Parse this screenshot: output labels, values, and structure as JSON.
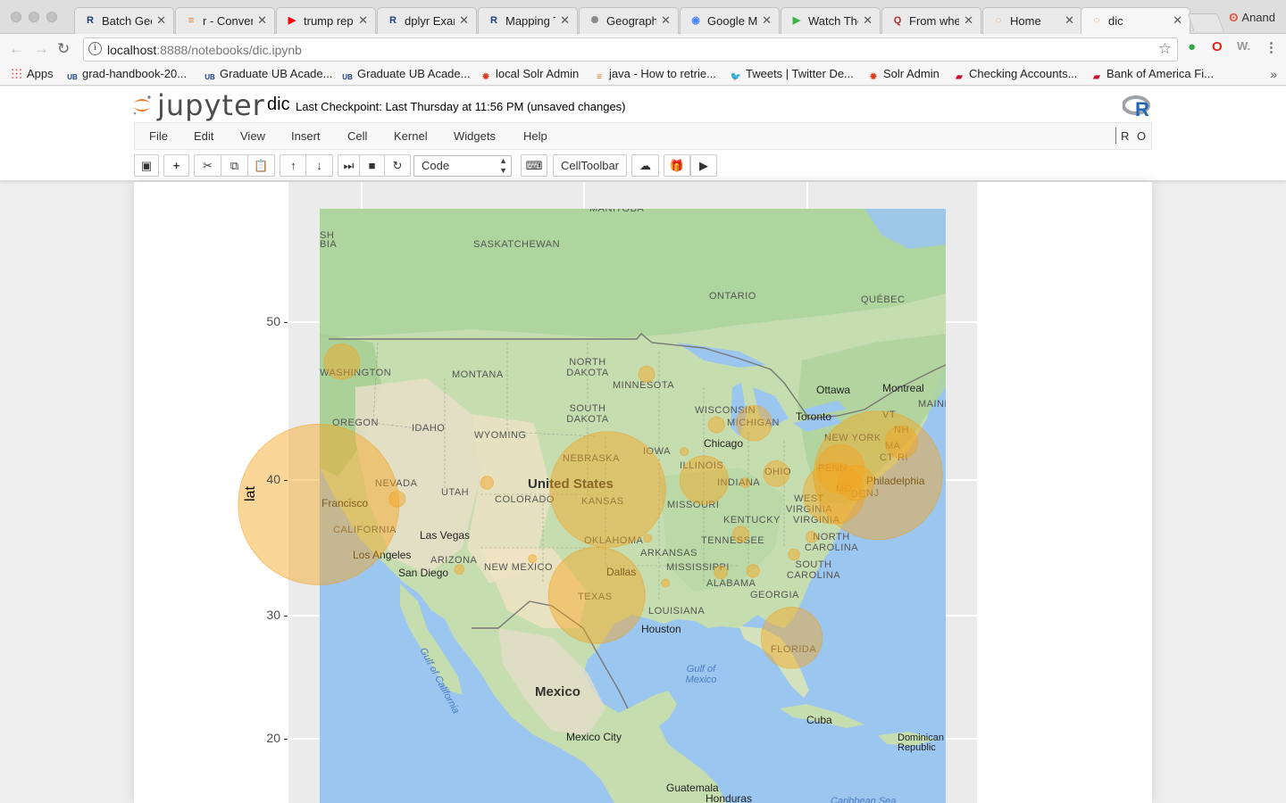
{
  "browser": {
    "tabs": [
      {
        "title": "Batch Geo",
        "icon": "r-icon",
        "color": "#1f3f7a"
      },
      {
        "title": "r - Conver",
        "icon": "stackoverflow-icon",
        "color": "#e87922"
      },
      {
        "title": "trump rep",
        "icon": "youtube-icon",
        "color": "#ff0000"
      },
      {
        "title": "dplyr Exan",
        "icon": "r-icon",
        "color": "#1f3f7a"
      },
      {
        "title": "Mapping T",
        "icon": "r-icon",
        "color": "#1f3f7a"
      },
      {
        "title": "Geographi",
        "icon": "loading-icon",
        "color": "#888888"
      },
      {
        "title": "Google Ma",
        "icon": "google-icon",
        "color": "#4285f4"
      },
      {
        "title": "Watch The",
        "icon": "play-icon",
        "color": "#3ab54a"
      },
      {
        "title": "From wher",
        "icon": "quora-icon",
        "color": "#b92b27"
      },
      {
        "title": "Home",
        "icon": "jupyter-icon",
        "color": "#f37726"
      },
      {
        "title": "dic",
        "icon": "jupyter-icon",
        "color": "#f37726"
      }
    ],
    "active_tab": 10,
    "profile_name": "Anand",
    "url_host": "localhost",
    "url_path": ":8888/notebooks/dic.ipynb",
    "bookmarks": [
      {
        "label": "Apps",
        "icon": "apps-grid-icon"
      },
      {
        "label": "grad-handbook-20...",
        "icon": "ub-icon"
      },
      {
        "label": "Graduate UB Acade...",
        "icon": "ub-icon"
      },
      {
        "label": "Graduate UB Acade...",
        "icon": "ub-icon"
      },
      {
        "label": "local Solr Admin",
        "icon": "solr-icon"
      },
      {
        "label": "java - How to retrie...",
        "icon": "stackoverflow-icon"
      },
      {
        "label": "Tweets | Twitter De...",
        "icon": "twitter-icon"
      },
      {
        "label": "Solr Admin",
        "icon": "solr-icon"
      },
      {
        "label": "Checking Accounts...",
        "icon": "bofa-icon"
      },
      {
        "label": "Bank of America Fi...",
        "icon": "bofa-icon"
      }
    ]
  },
  "jupyter": {
    "logo_text": "jupyter",
    "notebook_name": "dic",
    "checkpoint": "Last Checkpoint: Last Thursday at 11:56 PM (unsaved changes)",
    "menu": [
      "File",
      "Edit",
      "View",
      "Insert",
      "Cell",
      "Kernel",
      "Widgets",
      "Help"
    ],
    "kernel_indicator": "R",
    "kernel_status": "O",
    "cell_type": "Code",
    "celltoolbar_label": "CellToolbar",
    "toolbar_icons": [
      "save-icon",
      "plus-icon",
      "scissors-icon",
      "copy-icon",
      "paste-icon",
      "arrow-up-icon",
      "arrow-down-icon",
      "run-icon",
      "stop-icon",
      "restart-icon",
      "keyboard-icon",
      "upload-icon",
      "gift-icon",
      "video-icon"
    ]
  },
  "chart_data": {
    "type": "scatter",
    "ylabel": "lat",
    "y_ticks": [
      50,
      40,
      30,
      20
    ],
    "map_labels": {
      "regions": [
        "SASKATCHEWAN",
        "ONTARIO",
        "QUÉBEC",
        "WASHINGTON",
        "MONTANA",
        "NORTH DAKOTA",
        "MINNESOTA",
        "SOUTH DAKOTA",
        "OREGON",
        "IDAHO",
        "WYOMING",
        "WISCONSIN",
        "MICHIGAN",
        "NEW YORK",
        "VT",
        "NH",
        "MAINE",
        "MA",
        "CT",
        "RI",
        "NEBRASKA",
        "IOWA",
        "ILLINOIS",
        "INDIANA",
        "OHIO",
        "PENN",
        "MD",
        "DE",
        "NJ",
        "NEVADA",
        "UTAH",
        "COLORADO",
        "KANSAS",
        "MISSOURI",
        "WEST VIRGINIA",
        "VIRGINIA",
        "KENTUCKY",
        "CALIFORNIA",
        "ARIZONA",
        "NEW MEXICO",
        "OKLAHOMA",
        "ARKANSAS",
        "TENNESSEE",
        "NORTH CAROLINA",
        "SOUTH CAROLINA",
        "MISSISSIPPI",
        "ALABAMA",
        "GEORGIA",
        "TEXAS",
        "LOUISIANA",
        "FLORIDA",
        "SH",
        "BIA",
        "MANITOBA"
      ],
      "cities": [
        "Ottawa",
        "Montreal",
        "Toronto",
        "Chicago",
        "Philadelphia",
        "Francisco",
        "Las Vegas",
        "Los Angeles",
        "San Diego",
        "Dallas",
        "Houston",
        "Mexico City",
        "Cuba",
        "Guatemala",
        "Honduras",
        "Dominican Republic"
      ],
      "countries": [
        "United States",
        "Mexico"
      ],
      "water": [
        "Gulf of California",
        "Gulf of Mexico",
        "Caribbean Sea"
      ]
    },
    "points": [
      {
        "lon": -124.1,
        "lat": 38.2,
        "size": 100
      },
      {
        "lon": -73.6,
        "lat": 40.3,
        "size": 80
      },
      {
        "lon": -98.0,
        "lat": 39.3,
        "size": 72
      },
      {
        "lon": -99.0,
        "lat": 31.5,
        "size": 60
      },
      {
        "lon": -77.0,
        "lat": 40.7,
        "size": 30
      },
      {
        "lon": -77.6,
        "lat": 39.0,
        "size": 38
      },
      {
        "lon": -81.4,
        "lat": 28.2,
        "size": 38
      },
      {
        "lon": -122.0,
        "lat": 47.5,
        "size": 22
      },
      {
        "lon": -71.5,
        "lat": 42.4,
        "size": 20
      },
      {
        "lon": -89.3,
        "lat": 40.0,
        "size": 30
      },
      {
        "lon": -84.8,
        "lat": 43.6,
        "size": 22
      },
      {
        "lon": -75.6,
        "lat": 39.8,
        "size": 22
      },
      {
        "lon": -82.8,
        "lat": 40.4,
        "size": 16
      },
      {
        "lon": -86.0,
        "lat": 36.0,
        "size": 10
      },
      {
        "lon": -94.5,
        "lat": 46.7,
        "size": 10
      },
      {
        "lon": -88.2,
        "lat": 43.5,
        "size": 10
      },
      {
        "lon": -117.0,
        "lat": 38.6,
        "size": 10
      },
      {
        "lon": -87.8,
        "lat": 33.2,
        "size": 8
      },
      {
        "lon": -84.9,
        "lat": 33.3,
        "size": 8
      },
      {
        "lon": -81.2,
        "lat": 34.5,
        "size": 7
      },
      {
        "lon": -79.6,
        "lat": 35.8,
        "size": 7
      },
      {
        "lon": -108.9,
        "lat": 39.8,
        "size": 8
      },
      {
        "lon": -104.8,
        "lat": 34.2,
        "size": 5
      },
      {
        "lon": -111.4,
        "lat": 33.4,
        "size": 6
      },
      {
        "lon": -91.1,
        "lat": 41.8,
        "size": 5
      },
      {
        "lon": -85.6,
        "lat": 39.8,
        "size": 6
      },
      {
        "lon": -94.4,
        "lat": 35.7,
        "size": 5
      },
      {
        "lon": -92.8,
        "lat": 32.4,
        "size": 5
      }
    ]
  }
}
